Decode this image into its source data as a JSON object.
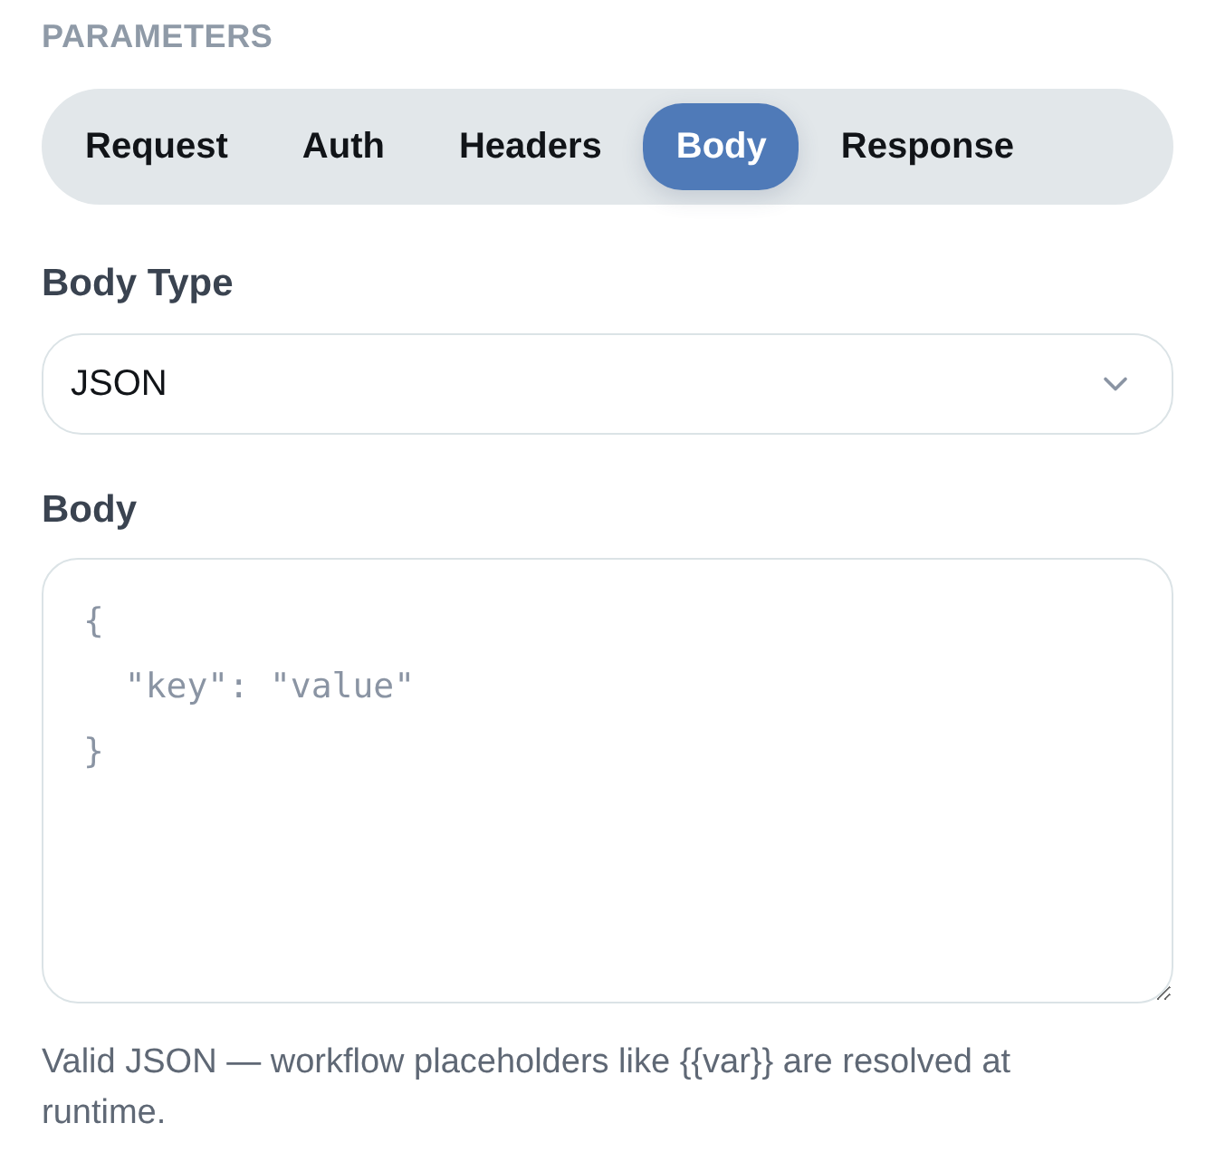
{
  "section_title": "PARAMETERS",
  "tabs": [
    {
      "label": "Request",
      "selected": false
    },
    {
      "label": "Auth",
      "selected": false
    },
    {
      "label": "Headers",
      "selected": false
    },
    {
      "label": "Body",
      "selected": true
    },
    {
      "label": "Response",
      "selected": false
    }
  ],
  "body_type": {
    "label": "Body Type",
    "value": "JSON"
  },
  "body": {
    "label": "Body",
    "placeholder": "{\n  \"key\": \"value\"\n}",
    "hint": "Valid JSON — workflow placeholders like {{var}} are resolved at runtime."
  }
}
